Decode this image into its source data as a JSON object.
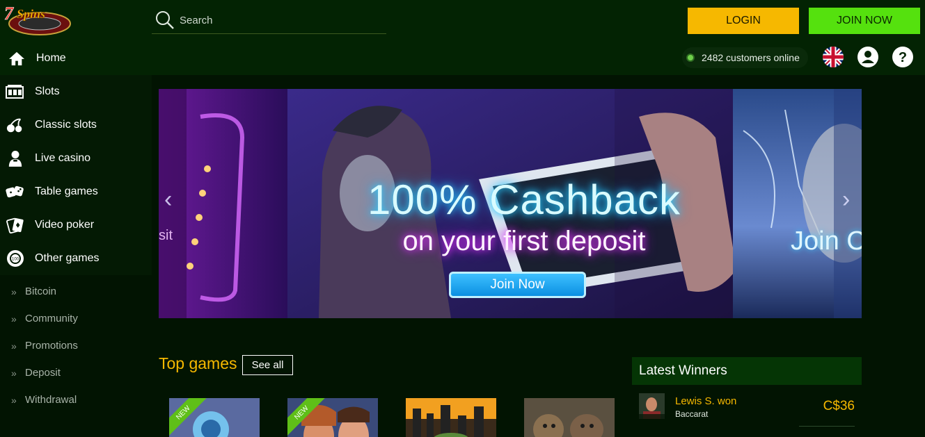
{
  "header": {
    "logo_text": "7Spins",
    "search_placeholder": "Search",
    "login_label": "LOGIN",
    "join_label": "JOIN NOW",
    "customers_online": "2482 customers online",
    "language": "uk-flag-icon"
  },
  "sidebar": {
    "home": "Home",
    "main_items": [
      {
        "label": "Slots",
        "icon": "slot-machine-icon"
      },
      {
        "label": "Classic slots",
        "icon": "cherries-icon"
      },
      {
        "label": "Live casino",
        "icon": "dealer-icon"
      },
      {
        "label": "Table games",
        "icon": "dice-icon"
      },
      {
        "label": "Video poker",
        "icon": "cards-icon"
      },
      {
        "label": "Other games",
        "icon": "chip-icon"
      }
    ],
    "sub_items": [
      {
        "label": "Bitcoin"
      },
      {
        "label": "Community"
      },
      {
        "label": "Promotions"
      },
      {
        "label": "Deposit"
      },
      {
        "label": "Withdrawal"
      }
    ]
  },
  "banner": {
    "headline": "100% Cashback",
    "subline": "on your first deposit",
    "cta": "Join Now",
    "left_partial_text": "sit",
    "right_partial_text": "Join C"
  },
  "top_games": {
    "title": "Top games",
    "see_all": "See all",
    "badges": [
      "NEW",
      "NEW"
    ]
  },
  "winners": {
    "title": "Latest Winners",
    "rows": [
      {
        "name": "Lewis S. won",
        "game": "Baccarat",
        "amount": "C$36"
      }
    ]
  },
  "colors": {
    "accent_yellow": "#f6b800",
    "accent_green": "#55e10e",
    "background": "#021402"
  }
}
